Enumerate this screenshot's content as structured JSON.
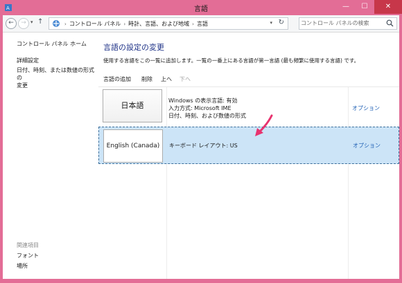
{
  "window": {
    "title": "言語",
    "controls": {
      "minimize": "—",
      "maximize": "☐",
      "close": "✕"
    }
  },
  "address": {
    "breadcrumbs": [
      "コントロール パネル",
      "時計、言語、および地域",
      "言語"
    ],
    "separator": "›"
  },
  "search": {
    "placeholder": "コントロール パネルの検索"
  },
  "sidebar": {
    "home": "コントロール パネル ホーム",
    "advanced": "詳細設定",
    "datetime_line1": "日付、時刻、または数値の形式の",
    "datetime_line2": "変更",
    "related_heading": "関連項目",
    "fonts": "フォント",
    "location": "場所"
  },
  "main": {
    "heading": "言語の設定の変更",
    "description": "使用する言語をこの一覧に追加します。一覧の一番上にある言語が第一言語 (最も頻繁に使用する言語) です。",
    "toolbar": {
      "add": "言語の追加",
      "remove": "削除",
      "up": "上へ",
      "down": "下へ"
    },
    "languages": [
      {
        "name": "日本語",
        "info": [
          "Windows の表示言語: 有効",
          "入力方式: Microsoft IME",
          "日付、時刻、および数値の形式"
        ],
        "options": "オプション"
      },
      {
        "name": "English (Canada)",
        "info": [
          "キーボード レイアウト: US"
        ],
        "options": "オプション"
      }
    ]
  },
  "colors": {
    "frame": "#e36d96",
    "heading": "#1e3287",
    "link": "#1e5fb4",
    "selection": "#cce4f7",
    "annotation_arrow": "#e8336f"
  }
}
